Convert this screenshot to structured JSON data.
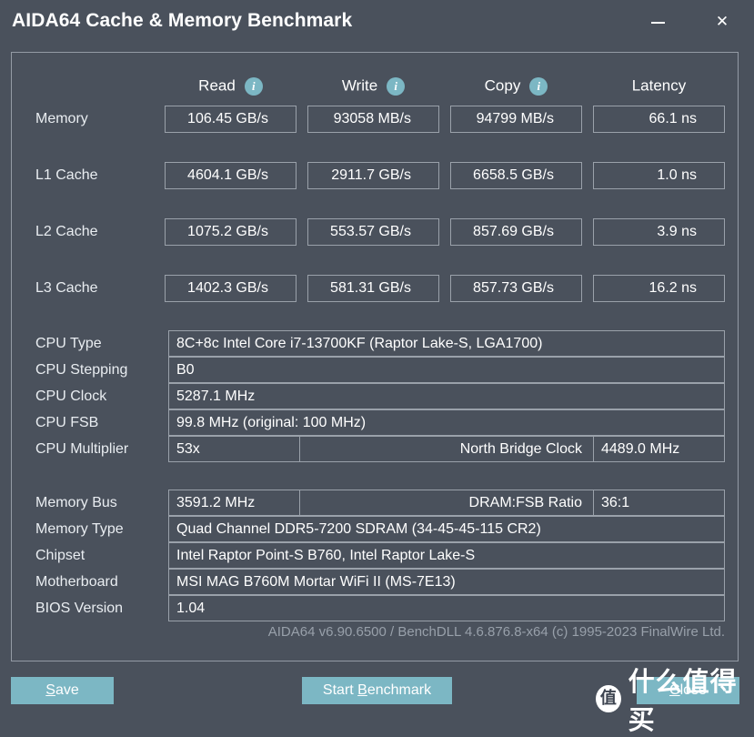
{
  "window": {
    "title": "AIDA64 Cache & Memory Benchmark",
    "minimize_label": "minimize",
    "close_label": "close"
  },
  "benchmark_table": {
    "columns": [
      {
        "label": "Read",
        "icon": "info-icon"
      },
      {
        "label": "Write",
        "icon": "info-icon"
      },
      {
        "label": "Copy",
        "icon": "info-icon"
      },
      {
        "label": "Latency",
        "icon": null
      }
    ],
    "rows": [
      {
        "label": "Memory",
        "read": "106.45 GB/s",
        "write": "93058 MB/s",
        "copy": "94799 MB/s",
        "latency": "66.1 ns"
      },
      {
        "label": "L1 Cache",
        "read": "4604.1 GB/s",
        "write": "2911.7 GB/s",
        "copy": "6658.5 GB/s",
        "latency": "1.0 ns"
      },
      {
        "label": "L2 Cache",
        "read": "1075.2 GB/s",
        "write": "553.57 GB/s",
        "copy": "857.69 GB/s",
        "latency": "3.9 ns"
      },
      {
        "label": "L3 Cache",
        "read": "1402.3 GB/s",
        "write": "581.31 GB/s",
        "copy": "857.73 GB/s",
        "latency": "16.2 ns"
      }
    ]
  },
  "cpu_info": {
    "cpu_type_label": "CPU Type",
    "cpu_type_value": "8C+8c Intel Core i7-13700KF  (Raptor Lake-S, LGA1700)",
    "cpu_stepping_label": "CPU Stepping",
    "cpu_stepping_value": "B0",
    "cpu_clock_label": "CPU Clock",
    "cpu_clock_value": "5287.1 MHz",
    "cpu_fsb_label": "CPU FSB",
    "cpu_fsb_value": "99.8 MHz  (original: 100 MHz)",
    "cpu_multiplier_label": "CPU Multiplier",
    "cpu_multiplier_value": "53x",
    "north_bridge_clock_label": "North Bridge Clock",
    "north_bridge_clock_value": "4489.0 MHz"
  },
  "memory_info": {
    "memory_bus_label": "Memory Bus",
    "memory_bus_value": "3591.2 MHz",
    "dram_fsb_ratio_label": "DRAM:FSB Ratio",
    "dram_fsb_ratio_value": "36:1",
    "memory_type_label": "Memory Type",
    "memory_type_value": "Quad Channel DDR5-7200 SDRAM  (34-45-45-115 CR2)",
    "chipset_label": "Chipset",
    "chipset_value": "Intel Raptor Point-S B760, Intel Raptor Lake-S",
    "motherboard_label": "Motherboard",
    "motherboard_value": "MSI MAG B760M Mortar WiFi II (MS-7E13)",
    "bios_version_label": "BIOS Version",
    "bios_version_value": "1.04"
  },
  "footer": {
    "version_text": "AIDA64 v6.90.6500 / BenchDLL 4.6.876.8-x64  (c) 1995-2023 FinalWire Ltd.",
    "save_button": {
      "prefix": "",
      "accel": "S",
      "suffix": "ave"
    },
    "start_button": {
      "prefix": "Start ",
      "accel": "B",
      "suffix": "enchmark"
    },
    "close_button": {
      "prefix": "",
      "accel": "C",
      "suffix": "lose"
    }
  },
  "watermark": {
    "badge": "值",
    "text": "什么值得买"
  },
  "colors": {
    "background": "#4a515c",
    "panel_border": "#949ba5",
    "box_border": "#9aa1aa",
    "accent_teal": "#7cb7c4",
    "text": "#e9edf1",
    "muted_text": "#98a0aa"
  }
}
